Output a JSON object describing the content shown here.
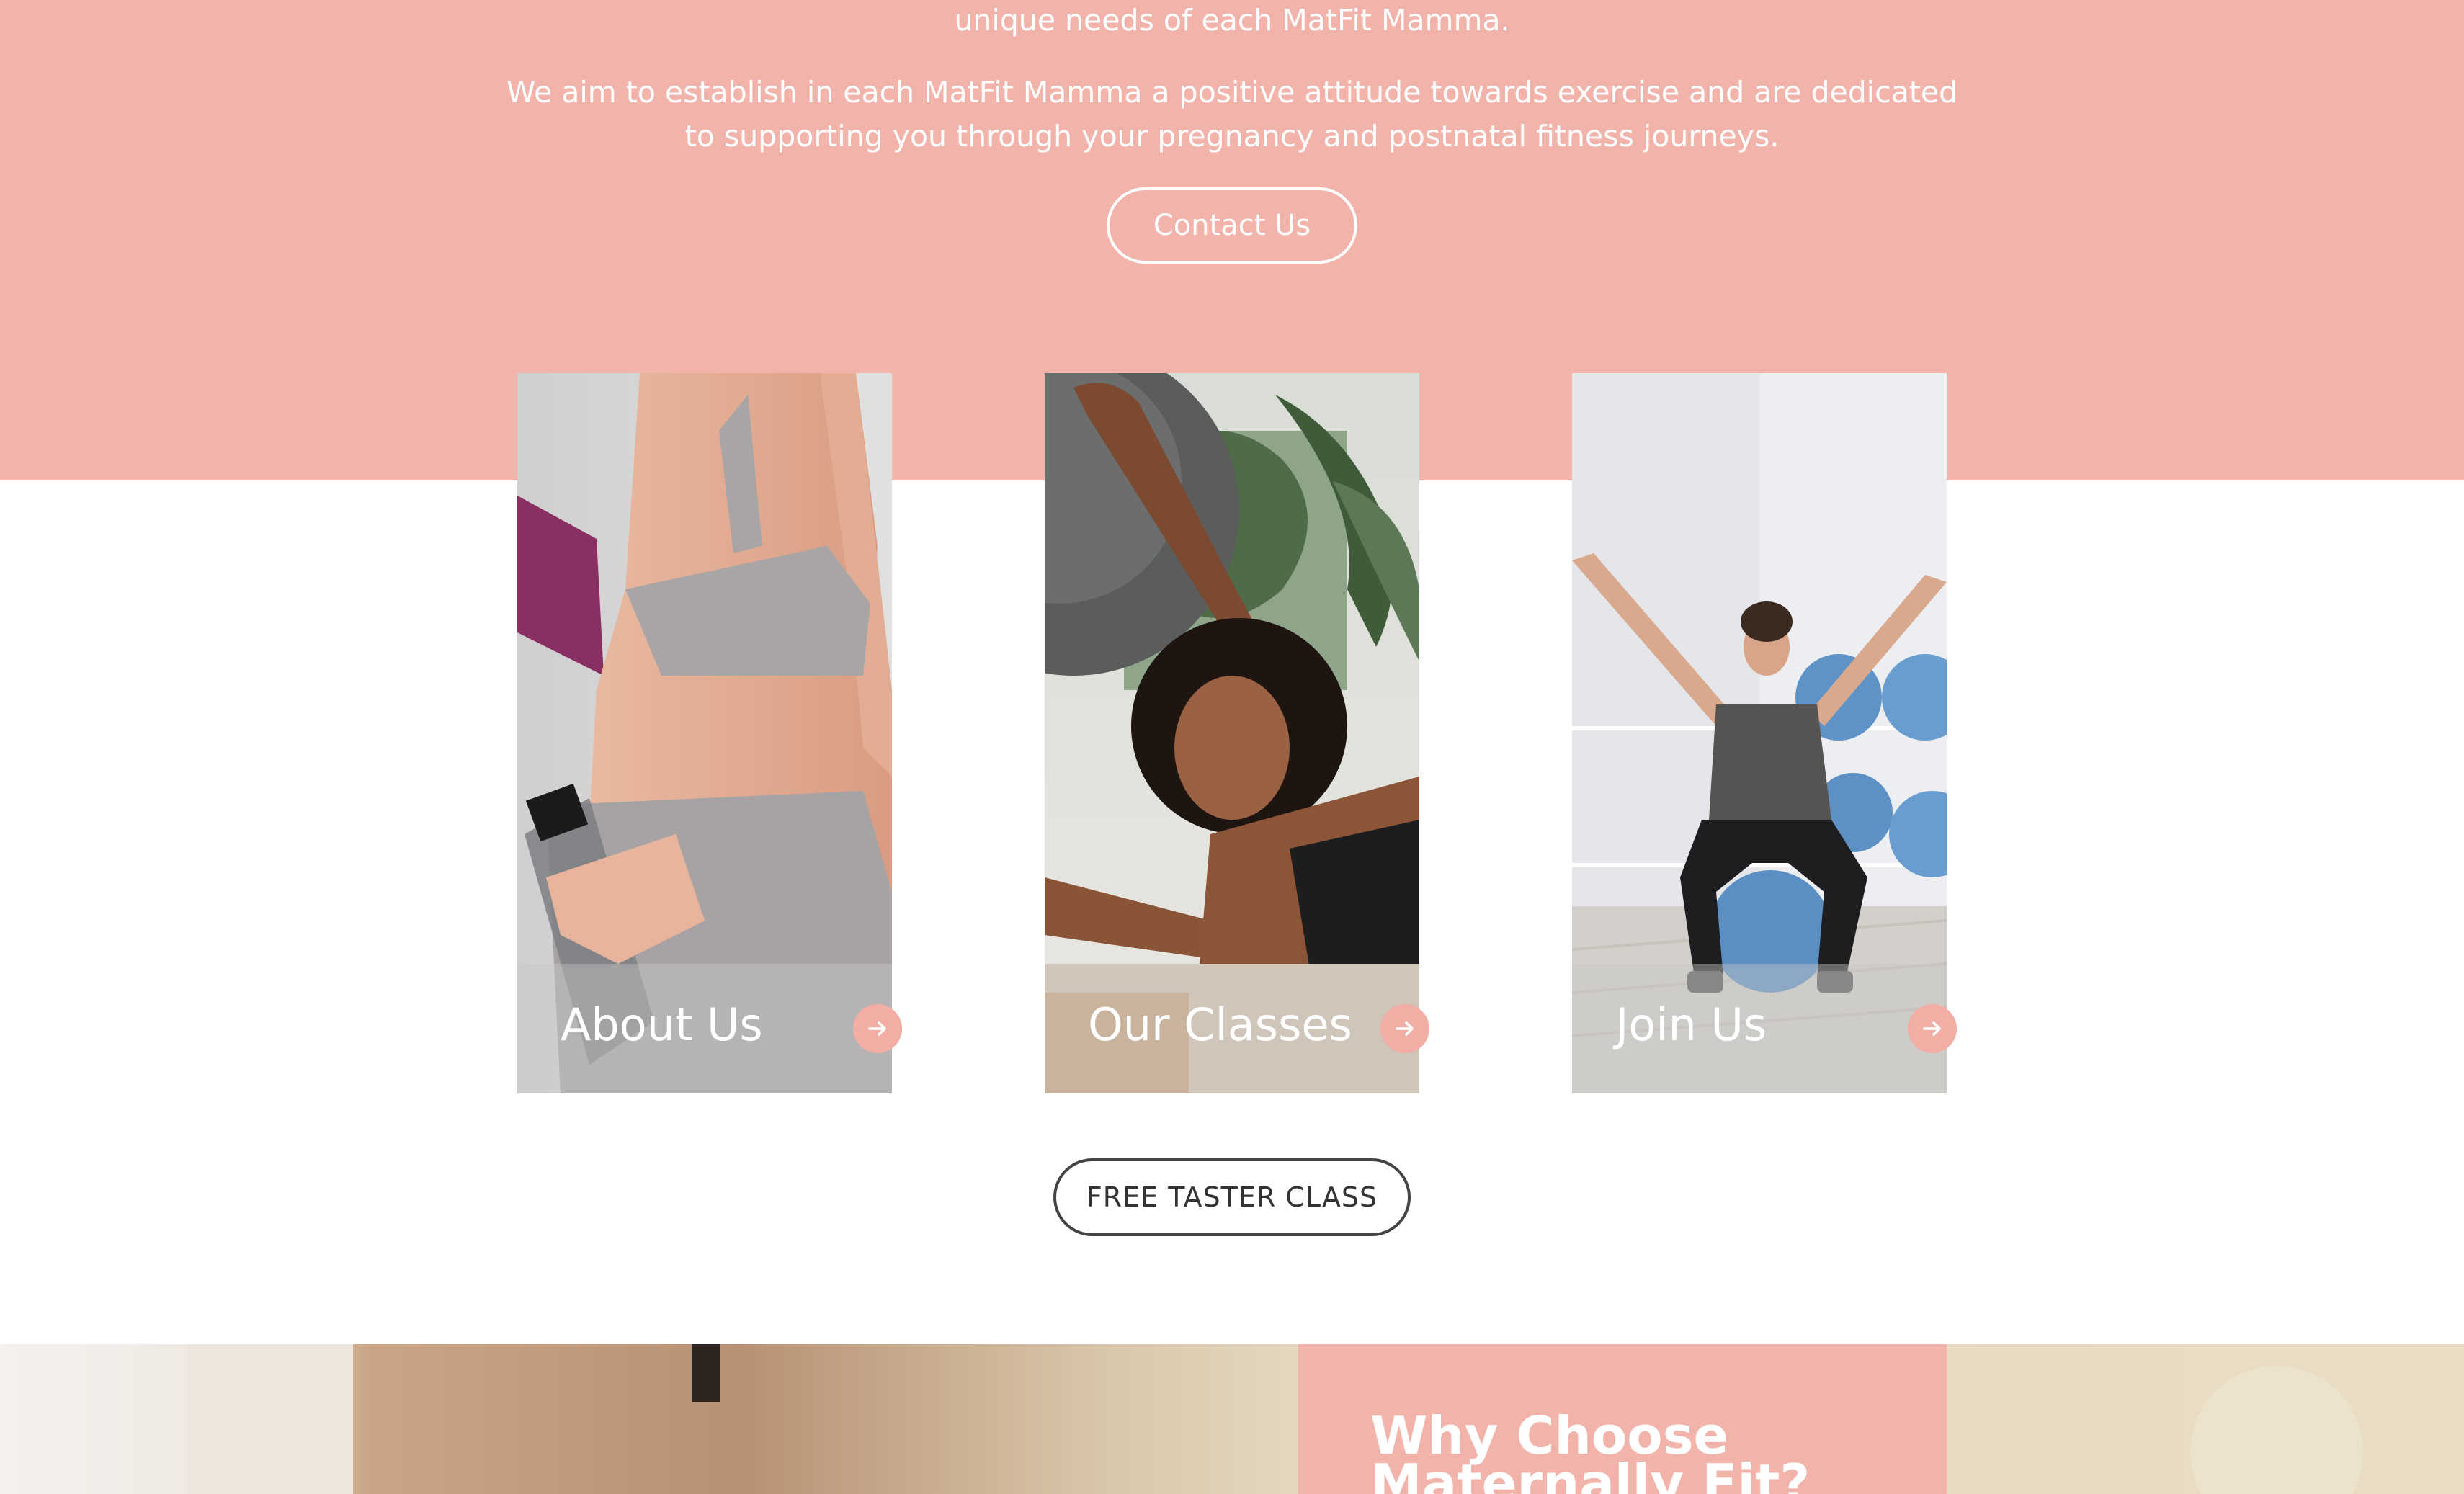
{
  "intro": {
    "line_1": "unique needs of each MatFit Mamma.",
    "line_2a": "We aim to establish in each MatFit Mamma a positive attitude towards exercise and are dedicated",
    "line_2b": "to supporting you through your pregnancy and postnatal fitness journeys.",
    "contact_label": "Contact Us"
  },
  "cards": [
    {
      "label": "About Us",
      "icon": "arrow-right-icon"
    },
    {
      "label": "Our Classes",
      "icon": "arrow-right-icon"
    },
    {
      "label": "Join Us",
      "icon": "arrow-right-icon"
    }
  ],
  "taster": {
    "label": "FREE TASTER CLASS"
  },
  "why": {
    "title": "Why Choose Maternally Fit?"
  },
  "colors": {
    "brand_pink": "#f2b3ab",
    "arrow_pink": "#f2aea4",
    "dark_text": "#333333"
  }
}
